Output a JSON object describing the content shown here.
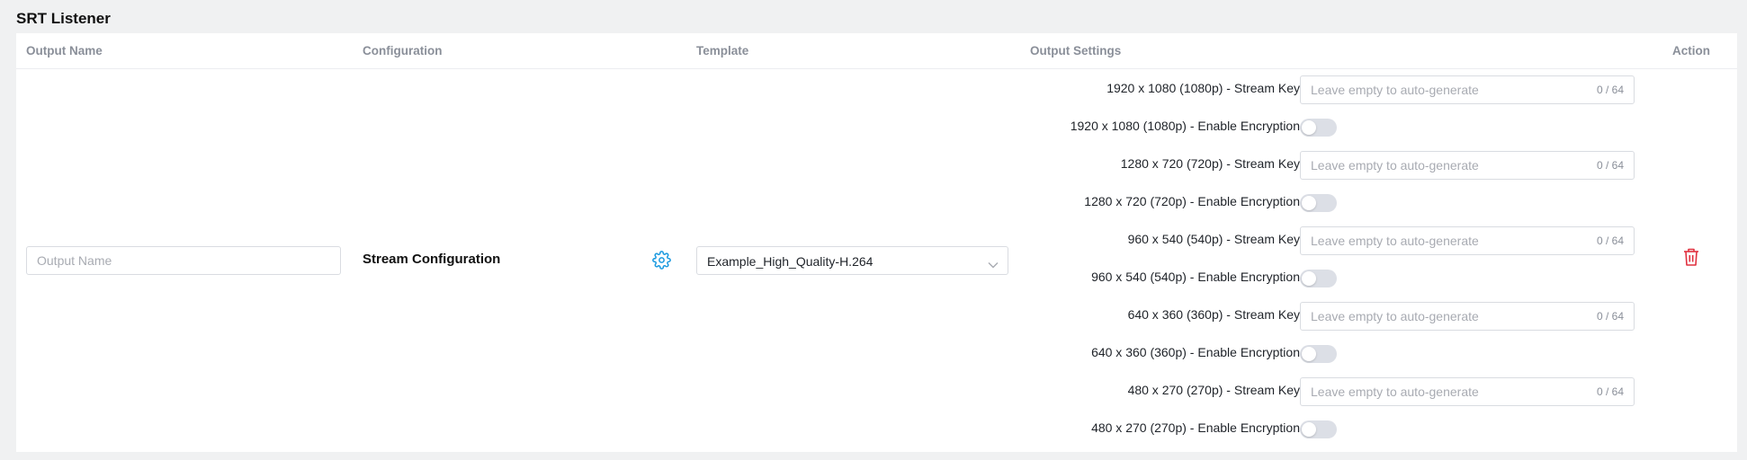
{
  "section": {
    "title": "SRT Listener"
  },
  "table": {
    "headers": {
      "output_name": "Output Name",
      "configuration": "Configuration",
      "template": "Template",
      "output_settings": "Output Settings",
      "action": "Action"
    }
  },
  "row": {
    "output_name": {
      "value": "",
      "placeholder": "Output Name"
    },
    "configuration": {
      "label": "Stream Configuration",
      "icon": "gear-icon"
    },
    "template": {
      "selected": "Example_High_Quality-H.264"
    },
    "action": {
      "icon": "trash-icon"
    }
  },
  "output_settings": [
    {
      "stream_key_label": "1920 x 1080 (1080p) - Stream Key",
      "stream_key_value": "",
      "stream_key_placeholder": "Leave empty to auto-generate",
      "counter": "0 / 64",
      "encryption_label": "1920 x 1080 (1080p) - Enable Encryption",
      "encryption_enabled": false
    },
    {
      "stream_key_label": "1280 x 720 (720p) - Stream Key",
      "stream_key_value": "",
      "stream_key_placeholder": "Leave empty to auto-generate",
      "counter": "0 / 64",
      "encryption_label": "1280 x 720 (720p) - Enable Encryption",
      "encryption_enabled": false
    },
    {
      "stream_key_label": "960 x 540 (540p) - Stream Key",
      "stream_key_value": "",
      "stream_key_placeholder": "Leave empty to auto-generate",
      "counter": "0 / 64",
      "encryption_label": "960 x 540 (540p) - Enable Encryption",
      "encryption_enabled": false
    },
    {
      "stream_key_label": "640 x 360 (360p) - Stream Key",
      "stream_key_value": "",
      "stream_key_placeholder": "Leave empty to auto-generate",
      "counter": "0 / 64",
      "encryption_label": "640 x 360 (360p) - Enable Encryption",
      "encryption_enabled": false
    },
    {
      "stream_key_label": "480 x 270 (270p) - Stream Key",
      "stream_key_value": "",
      "stream_key_placeholder": "Leave empty to auto-generate",
      "counter": "0 / 64",
      "encryption_label": "480 x 270 (270p) - Enable Encryption",
      "encryption_enabled": false
    }
  ],
  "colors": {
    "accent": "#1e9be0",
    "danger": "#e0303f",
    "toggle_off": "#dcdfe6",
    "border": "#d9dce1"
  }
}
